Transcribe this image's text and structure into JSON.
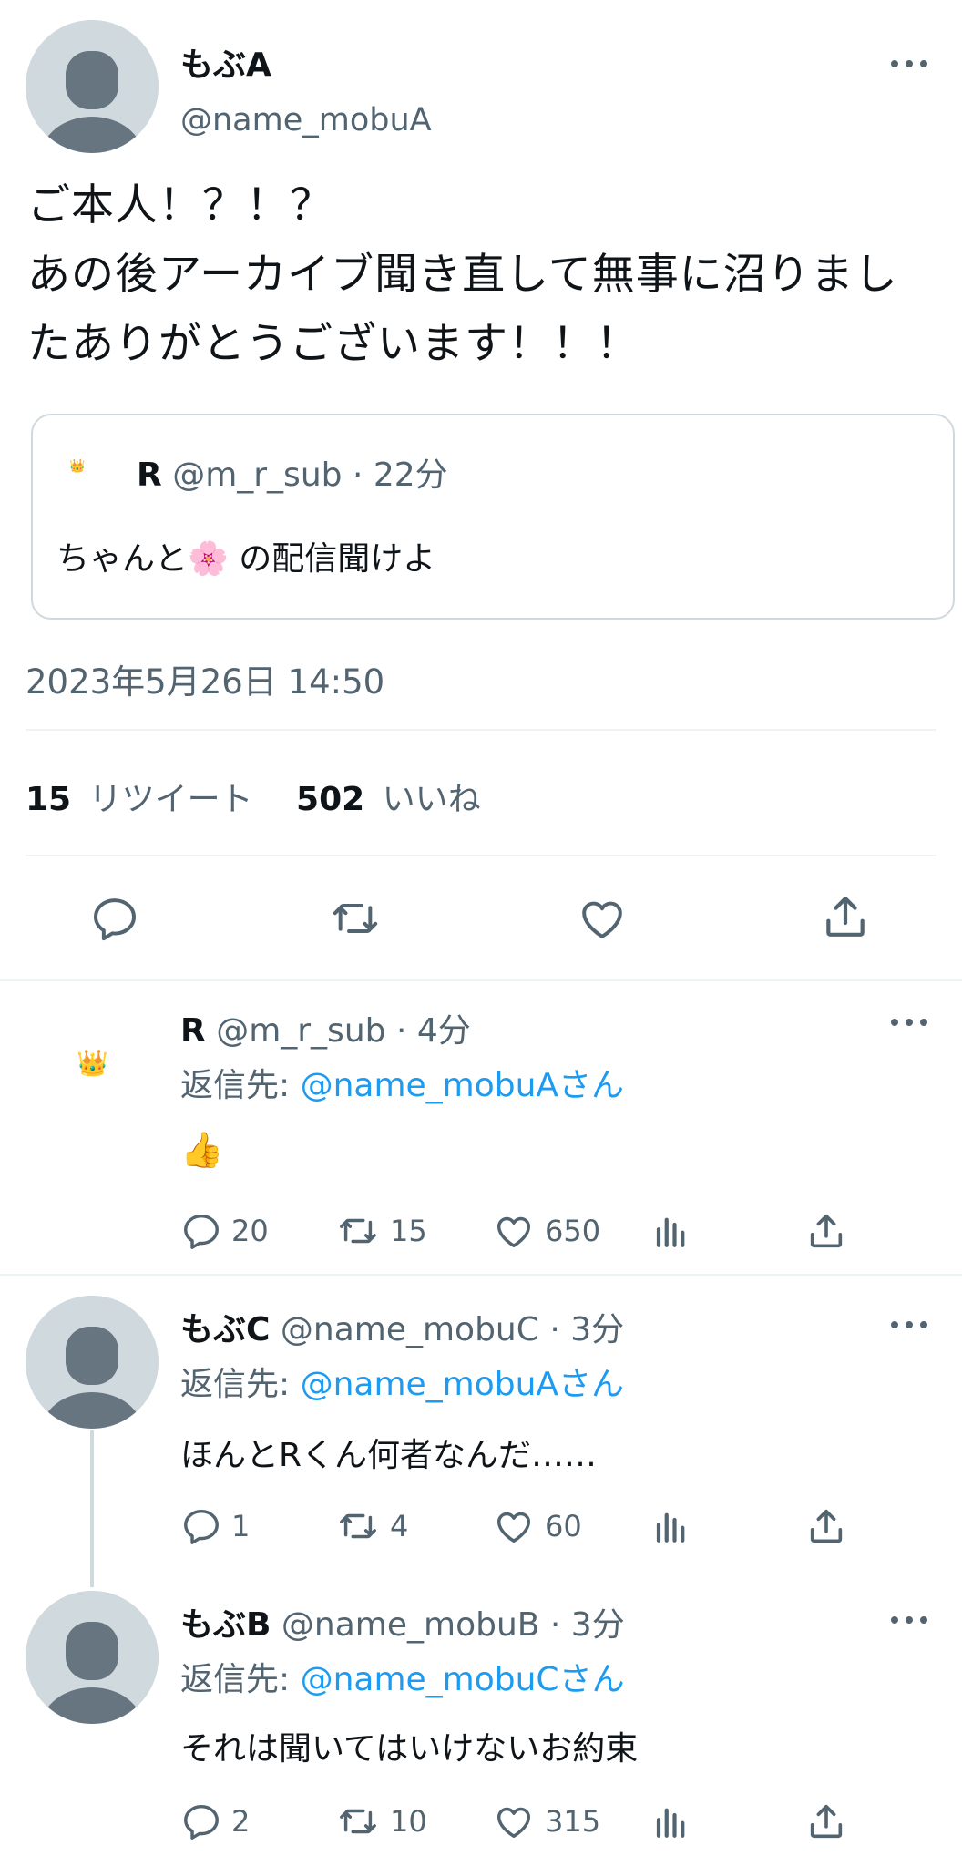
{
  "main_tweet": {
    "display_name": "もぶA",
    "handle": "@name_mobuA",
    "text_line1": "ご本人！？！？",
    "text_line2": "あの後アーカイブ聞き直して無事に沼りまし",
    "text_line3": "たありがとうございます！！！",
    "quote": {
      "display_name": "R",
      "handle": "@m_r_sub",
      "time": "· 22分",
      "text_before": "ちゃんと",
      "emoji": "🌸",
      "text_after": " の配信聞けよ"
    },
    "timestamp": "2023年5月26日 14:50",
    "retweet_count": "15",
    "retweet_label": "リツイート",
    "like_count": "502",
    "like_label": "いいね"
  },
  "replies": [
    {
      "display_name": "R",
      "handle": "@m_r_sub",
      "time": "· 4分",
      "reply_prefix": "返信先: ",
      "reply_to": "@name_mobuAさん",
      "text": "👍",
      "avatar_emoji": "👑",
      "replies": "20",
      "retweets": "15",
      "likes": "650"
    },
    {
      "display_name": "もぶC",
      "handle": "@name_mobuC",
      "time": "· 3分",
      "reply_prefix": "返信先: ",
      "reply_to": "@name_mobuAさん",
      "text": "ほんとRくん何者なんだ……",
      "replies": "1",
      "retweets": "4",
      "likes": "60"
    },
    {
      "display_name": "もぶB",
      "handle": "@name_mobuB",
      "time": "· 3分",
      "reply_prefix": "返信先: ",
      "reply_to": "@name_mobuCさん",
      "text": "それは聞いてはいけないお約束",
      "replies": "2",
      "retweets": "10",
      "likes": "315"
    }
  ],
  "colors": {
    "text": "#0f1419",
    "secondary": "#536471",
    "link": "#1d9bf0",
    "avatar_bg": "#cfd9de",
    "avatar_fg": "#6b7b8a",
    "divider": "#eff3f4"
  },
  "icons": [
    "more-icon",
    "reply-icon",
    "retweet-icon",
    "like-icon",
    "share-icon",
    "analytics-icon",
    "crown-icon"
  ]
}
